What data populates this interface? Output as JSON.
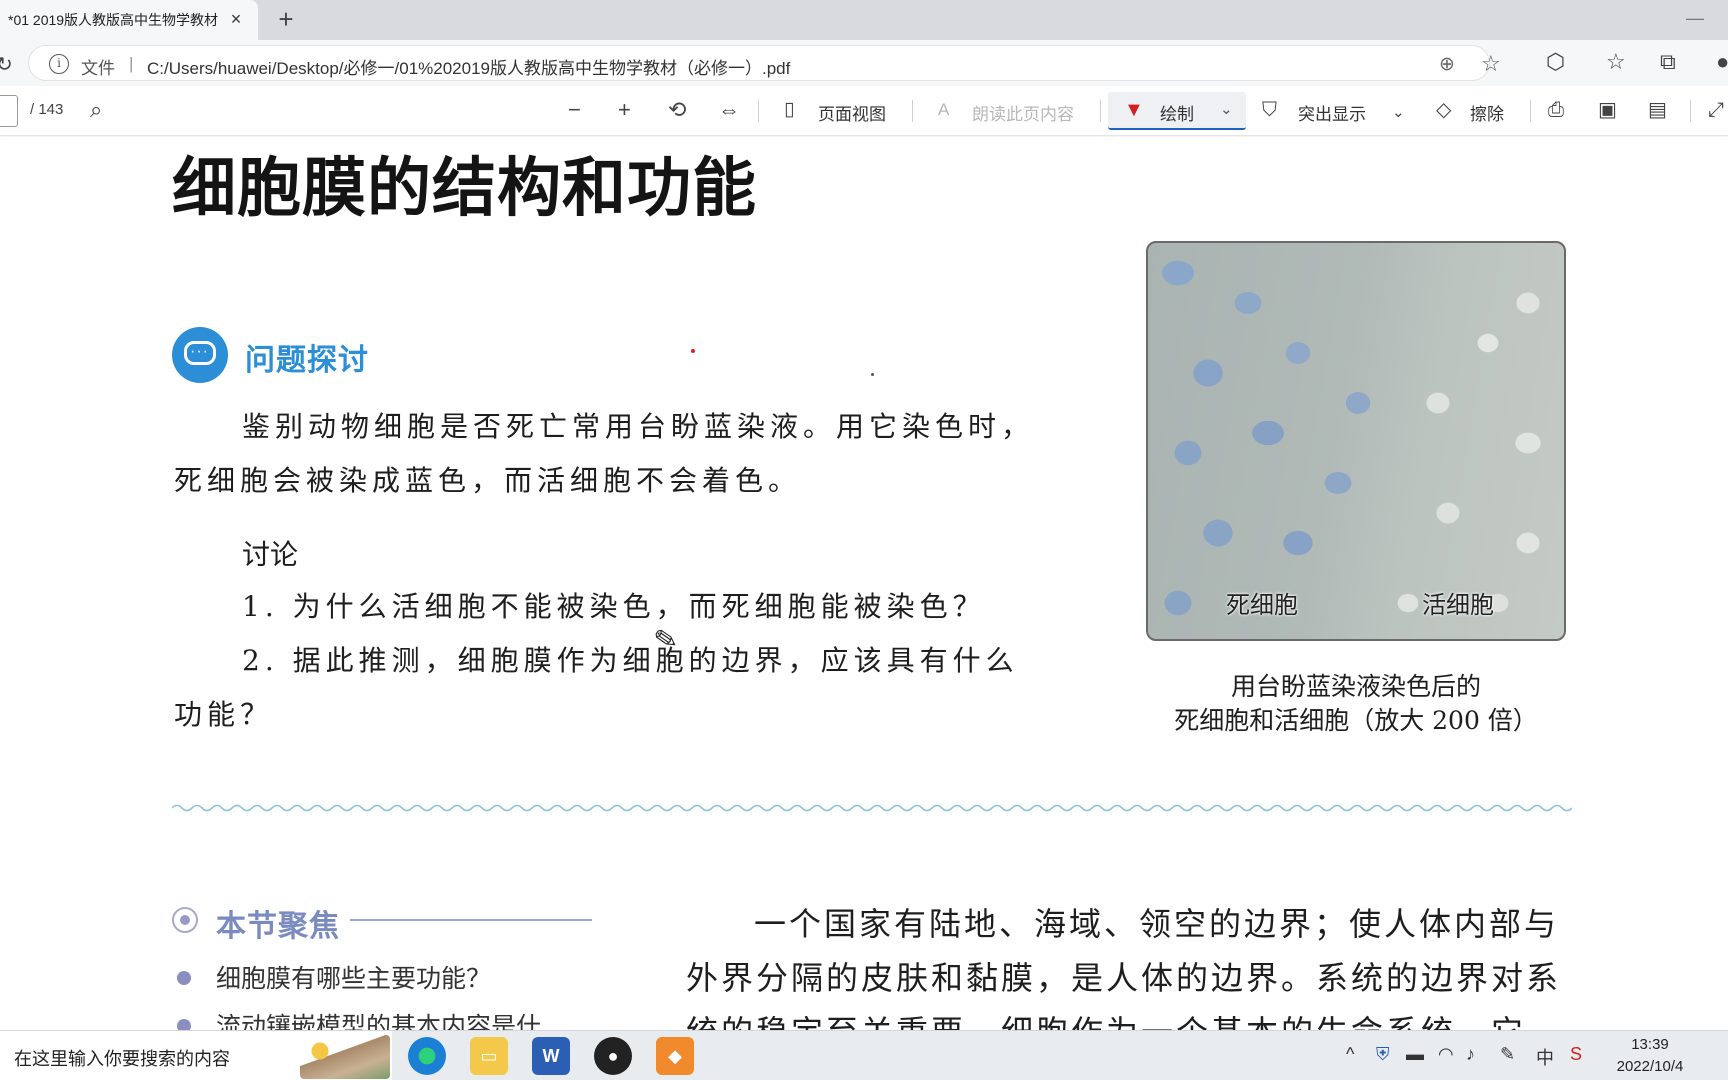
{
  "browser": {
    "tab_title": "*01 2019版人教版高中生物学教材",
    "tab_close": "×",
    "new_tab": "+",
    "address_label": "文件",
    "address_separator": "|",
    "url": "C:/Users/huawei/Desktop/必修一/01%202019版人教版高中生物学教材（必修一）.pdf"
  },
  "pdf_toolbar": {
    "page_total": "/ 143",
    "zoom_out": "−",
    "zoom_in": "+",
    "page_view_label": "页面视图",
    "read_aloud_label": "朗读此页内容",
    "draw_label": "绘制",
    "highlight_label": "突出显示",
    "erase_label": "擦除"
  },
  "content": {
    "heading": "细胞膜的结构和功能",
    "question_title": "问题探讨",
    "question_line1": "鉴别动物细胞是否死亡常用台盼蓝染液。用它染色时，",
    "question_line2": "死细胞会被染成蓝色，而活细胞不会着色。",
    "discuss_title": "讨论",
    "discuss_item1": "1.  为什么活细胞不能被染色，而死细胞能被染色？",
    "discuss_item2_line1": "2.  据此推测，细胞膜作为细胞的边界，应该具有什么",
    "discuss_item2_line2": "功能？",
    "photo_label_dead": "死细胞",
    "photo_label_live": "活细胞",
    "caption_line1": "用台盼蓝染液染色后的",
    "caption_line2": "死细胞和活细胞（放大 200 倍）",
    "focus_title": "本节聚焦",
    "focus_item1": "细胞膜有哪些主要功能？",
    "focus_item2": "流动镶嵌模型的基本内容是什",
    "para_line1": "一个国家有陆地、海域、领空的边界；使人体内部与",
    "para_line2": "外界分隔的皮肤和黏膜，是人体的边界。系统的边界对系",
    "para_line3": "统的稳定至关重要。细胞作为一个基本的生命系统，它"
  },
  "taskbar": {
    "search_placeholder": "在这里输入你要搜索的内容",
    "word_label": "W",
    "time": "13:39",
    "date": "2022/10/4",
    "ime": "中"
  },
  "colors": {
    "accent_blue": "#2b8ed6",
    "draw_red": "#d42020",
    "focus_purple": "#7b8bbf"
  }
}
